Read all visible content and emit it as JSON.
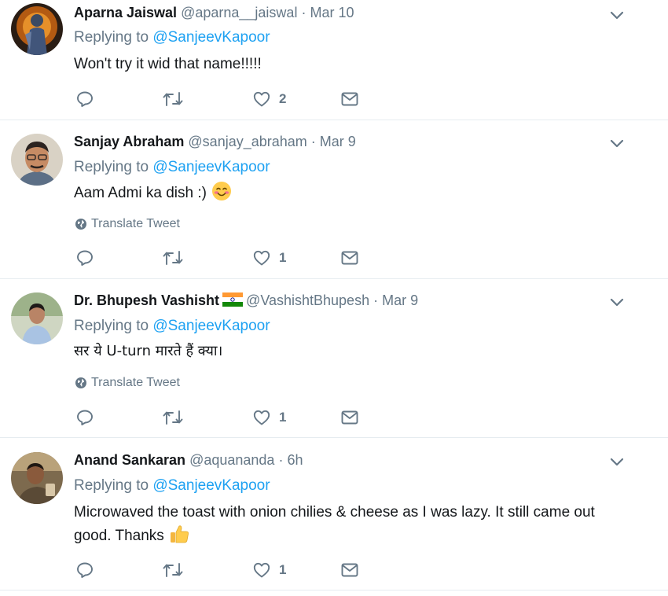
{
  "replying_label": "Replying to",
  "translate_label": "Translate Tweet",
  "tweets": [
    {
      "name": "Aparna Jaiswal",
      "handle": "@aparna__jaiswal",
      "time": "Mar 10",
      "mention": "@SanjeevKapoor",
      "text": "Won't try it wid that name!!!!!",
      "likes": "2",
      "avatar_icon": "avatar-deity-icon"
    },
    {
      "name": "Sanjay Abraham",
      "handle": "@sanjay_abraham",
      "time": "Mar 9",
      "mention": "@SanjeevKapoor",
      "text": "Aam Admi ka dish :)",
      "likes": "1",
      "emoji": "smiling-face-icon"
    },
    {
      "name": "Dr. Bhupesh Vashisht",
      "handle": "@VashishtBhupesh",
      "time": "Mar 9",
      "mention": "@SanjeevKapoor",
      "text": "सर ये U-turn मारते हैं क्या।",
      "likes": "1",
      "flag_icon": "india-flag-icon"
    },
    {
      "name": "Anand Sankaran",
      "handle": "@aquananda",
      "time": "6h",
      "mention": "@SanjeevKapoor",
      "text_line1": "Microwaved the toast with onion chilies & cheese as I was lazy. It still came out",
      "text_line2": "good. Thanks",
      "likes": "1",
      "emoji": "thumbs-up-icon"
    }
  ],
  "colors": {
    "link": "#1da1f2",
    "muted": "#657786",
    "text": "#14171a",
    "divider": "#e6ecf0"
  }
}
